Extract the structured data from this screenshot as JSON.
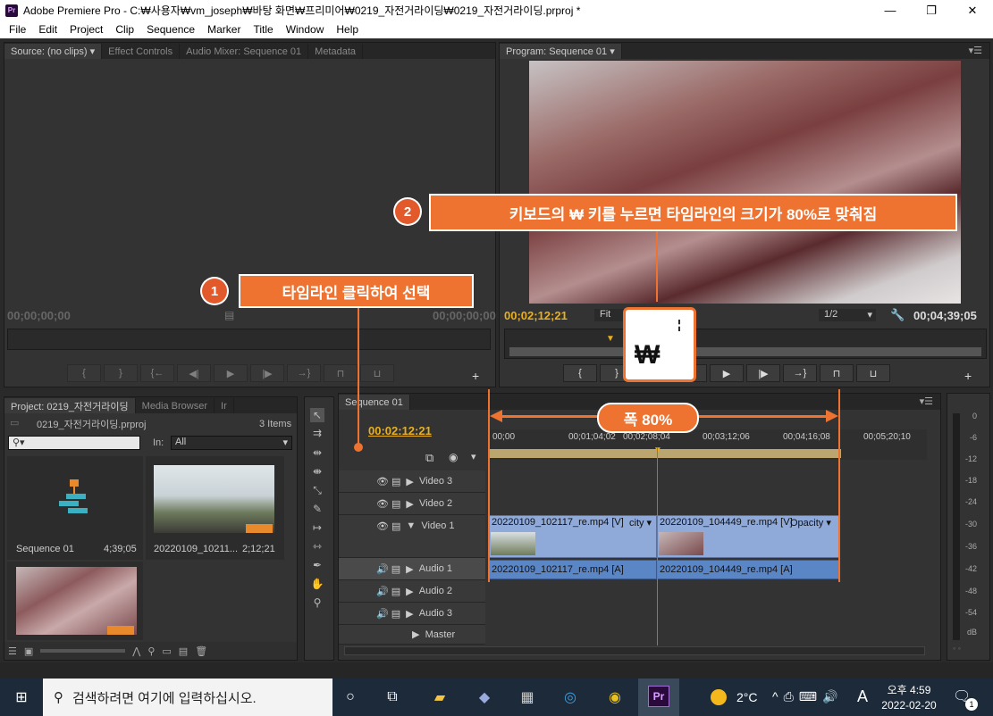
{
  "window": {
    "title": "Adobe Premiere Pro - C:₩사용자₩vm_joseph₩바탕 화면₩프리미어₩0219_자전거라이딩₩0219_자전거라이딩.prproj *",
    "app_icon": "Pr"
  },
  "menu": [
    "File",
    "Edit",
    "Project",
    "Clip",
    "Sequence",
    "Marker",
    "Title",
    "Window",
    "Help"
  ],
  "source_panel": {
    "tabs": [
      "Source: (no clips)",
      "Effect Controls",
      "Audio Mixer: Sequence 01",
      "Metadata"
    ],
    "timecode": "00;00;00;00"
  },
  "program_panel": {
    "tab": "Program: Sequence 01",
    "timecode_left": "00;02;12;21",
    "fit": "Fit",
    "resolution": "1/2",
    "timecode_right": "00;04;39;05"
  },
  "project_panel": {
    "tabs": [
      "Project: 0219_자전거라이딩",
      "Media Browser",
      "Ir"
    ],
    "file": "0219_자전거라이딩.prproj",
    "items_count": "3 Items",
    "in_label": "In:",
    "in_value": "All",
    "items": [
      {
        "name": "Sequence 01",
        "duration": "4;39;05"
      },
      {
        "name": "20220109_10211...",
        "duration": "2;12;21"
      },
      {
        "name": "",
        "duration": ""
      }
    ]
  },
  "timeline": {
    "tab": "Sequence 01",
    "timecode": "00:02:12:21",
    "ruler": [
      "00;00",
      "00;01;04;02",
      "00;02;08;04",
      "00;03;12;06",
      "00;04;16;08",
      "00;05;20;10"
    ],
    "tracks": [
      {
        "name": "Video 3",
        "kind": "video"
      },
      {
        "name": "Video 2",
        "kind": "video"
      },
      {
        "name": "Video 1",
        "kind": "video"
      },
      {
        "name": "Audio 1",
        "kind": "audio"
      },
      {
        "name": "Audio 2",
        "kind": "audio"
      },
      {
        "name": "Audio 3",
        "kind": "audio"
      },
      {
        "name": "Master",
        "kind": "master"
      }
    ],
    "clips": {
      "v1a": "20220109_102117_re.mp4 [V]",
      "v1a_tail": "city ▾",
      "v1b": "20220109_104449_re.mp4 [V]",
      "v1b_tail": "Opacity ▾",
      "a1a": "20220109_102117_re.mp4 [A]",
      "a1b": "20220109_104449_re.mp4 [A]"
    }
  },
  "meter": {
    "labels": [
      "0",
      "-6",
      "-12",
      "-18",
      "-24",
      "-30",
      "-36",
      "-42",
      "-48",
      "-54",
      "dB"
    ],
    "footer": "◦ ◦"
  },
  "callouts": {
    "c1_num": "1",
    "c1_text": "타임라인 클릭하여 선택",
    "c2_num": "2",
    "c2_text": "키보드의 ₩ 키를 누르면 타임라인의 크기가 80%로 맞춰짐",
    "zoom_text": "폭 80%",
    "key_label": "₩"
  },
  "taskbar": {
    "search": "검색하려면 여기에 입력하십시오.",
    "weather": "2°C",
    "ime": "A",
    "time": "오후 4:59",
    "date": "2022-02-20",
    "notify": "1"
  },
  "colors": {
    "accent_orange": "#ee7330",
    "timecode_yellow": "#e8b020",
    "clip_blue": "#8fa9d8",
    "audio_blue": "#5b86c6"
  }
}
